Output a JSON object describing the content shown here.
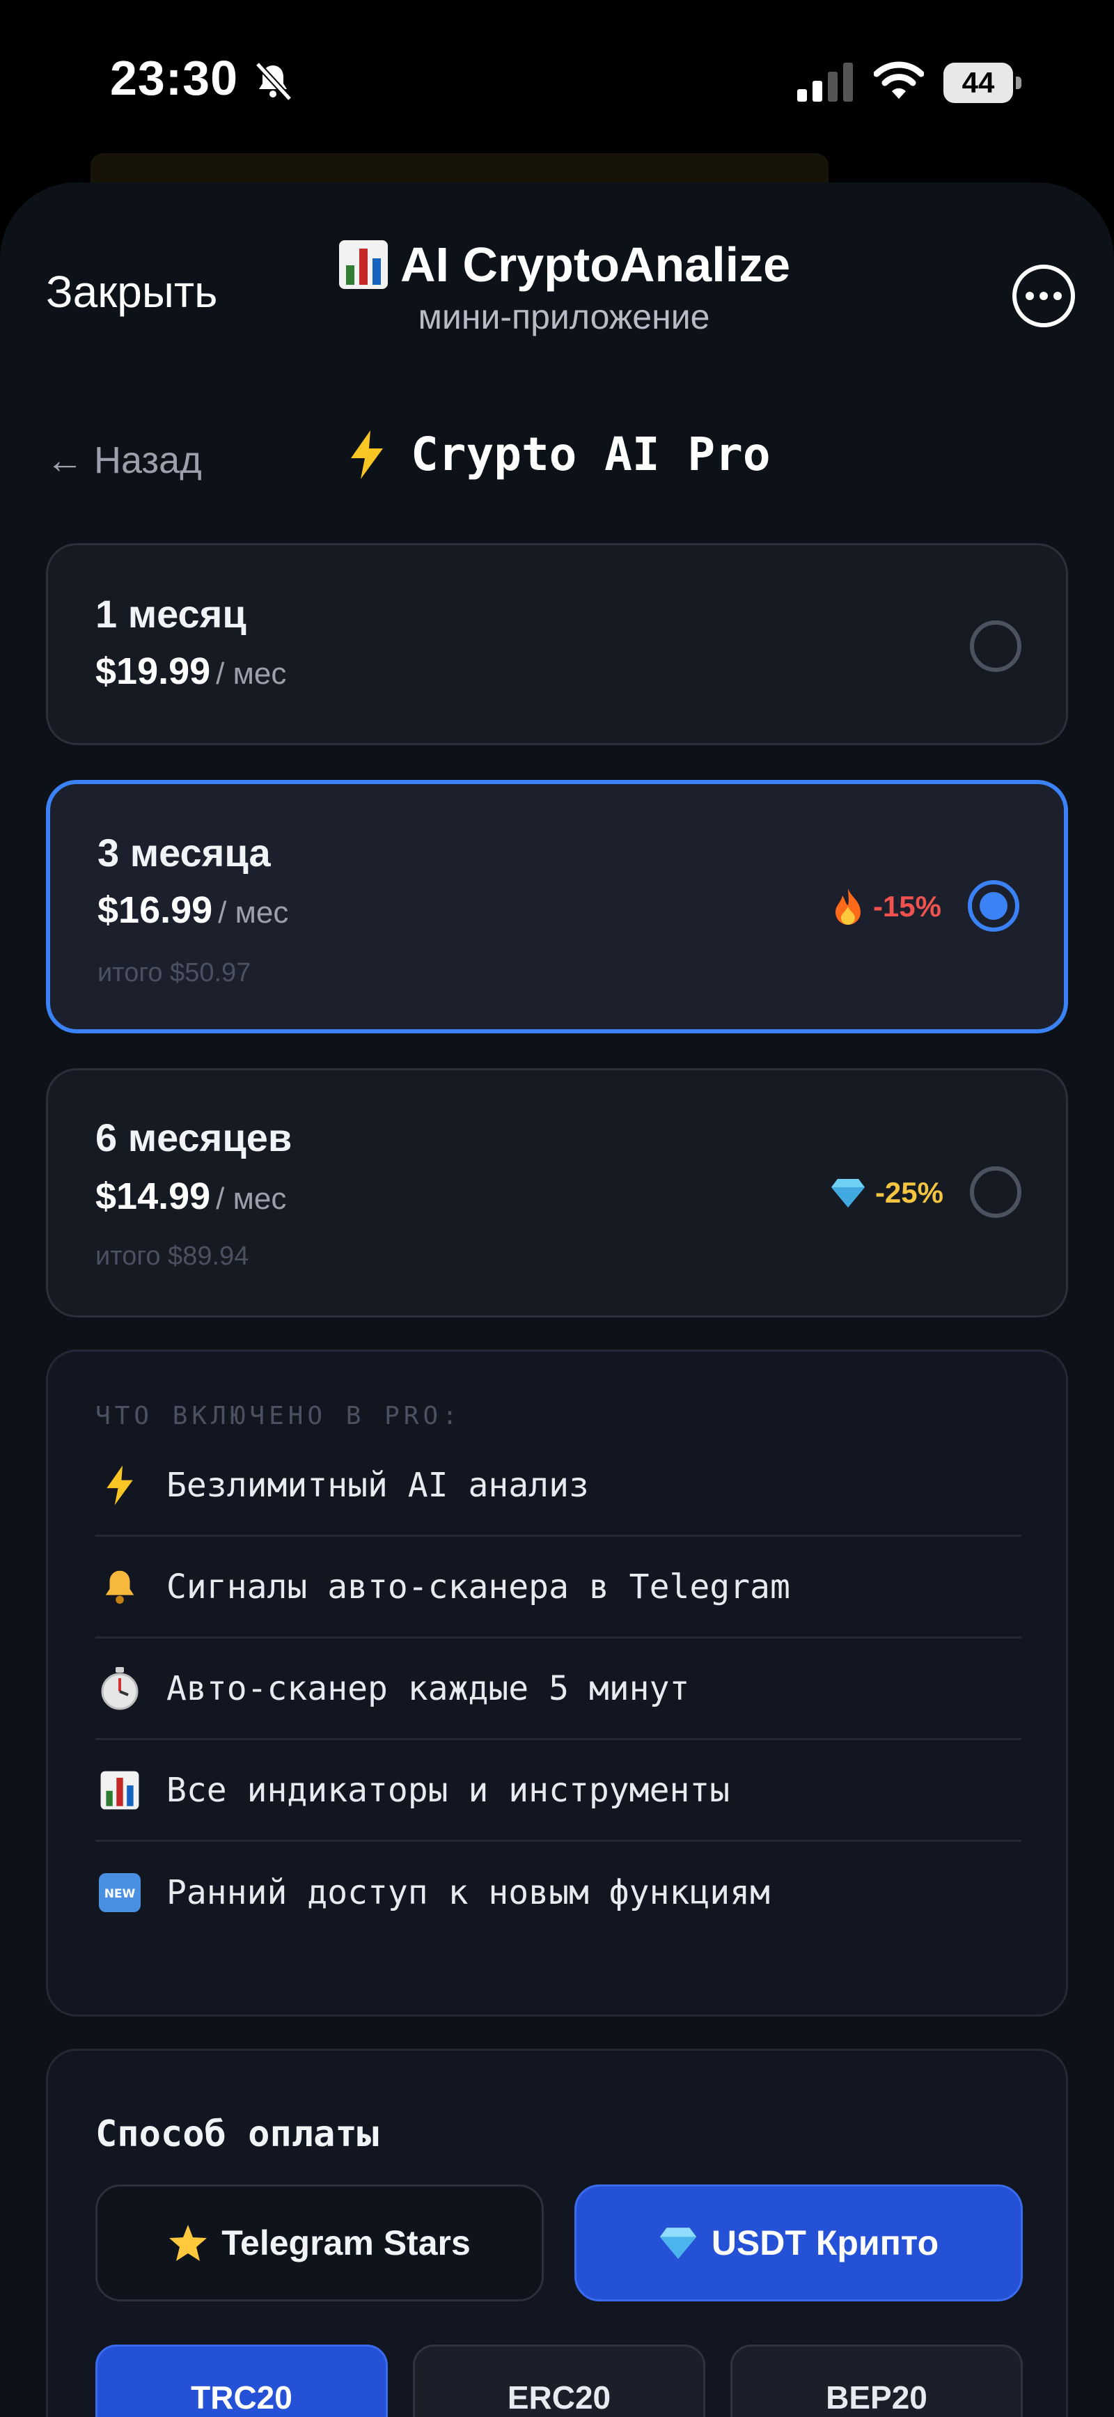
{
  "status_bar": {
    "time": "23:30",
    "battery": "44"
  },
  "header": {
    "close_label": "Закрыть",
    "app_name": "AI CryptoAnalize",
    "app_subtitle": "мини-приложение"
  },
  "nav": {
    "back_label": "← Назад",
    "title": "Crypto AI Pro",
    "title_icon": "lightning-icon"
  },
  "plans": [
    {
      "name": "1 месяц",
      "price": "$19.99",
      "per": "/ мес",
      "total": "",
      "badge": "",
      "badge_icon": "",
      "selected": false
    },
    {
      "name": "3 месяца",
      "price": "$16.99",
      "per": "/ мес",
      "total": "итого $50.97",
      "badge": "-15%",
      "badge_icon": "fire-icon",
      "badge_color": "#ef5350",
      "selected": true
    },
    {
      "name": "6 месяцев",
      "price": "$14.99",
      "per": "/ мес",
      "total": "итого $89.94",
      "badge": "-25%",
      "badge_icon": "diamond-icon",
      "badge_color": "#f5c542",
      "selected": false
    }
  ],
  "features": {
    "heading": "ЧТО ВКЛЮЧЕНО В PRO:",
    "items": [
      {
        "icon": "lightning-icon",
        "label": "Безлимитный AI анализ"
      },
      {
        "icon": "bell-icon",
        "label": "Сигналы авто-сканера в Telegram"
      },
      {
        "icon": "stopwatch-icon",
        "label": "Авто-сканер каждые 5 минут"
      },
      {
        "icon": "chart-icon",
        "label": "Все индикаторы и инструменты"
      },
      {
        "icon": "new-icon",
        "label": "Ранний доступ к новым функциям"
      }
    ]
  },
  "payment": {
    "heading": "Способ оплаты",
    "options": [
      {
        "icon": "star-icon",
        "label": "Telegram Stars",
        "selected": false
      },
      {
        "icon": "diamond-icon",
        "label": "USDT Крипто",
        "selected": true
      }
    ],
    "networks": [
      {
        "label": "TRC20",
        "selected": true
      },
      {
        "label": "ERC20",
        "selected": false
      },
      {
        "label": "BEP20",
        "selected": false
      }
    ]
  },
  "colors": {
    "accent": "#3b82f6",
    "accent_fill": "#2451d6",
    "sheet_bg": "#0d1118",
    "card_bg": "#161a23"
  }
}
